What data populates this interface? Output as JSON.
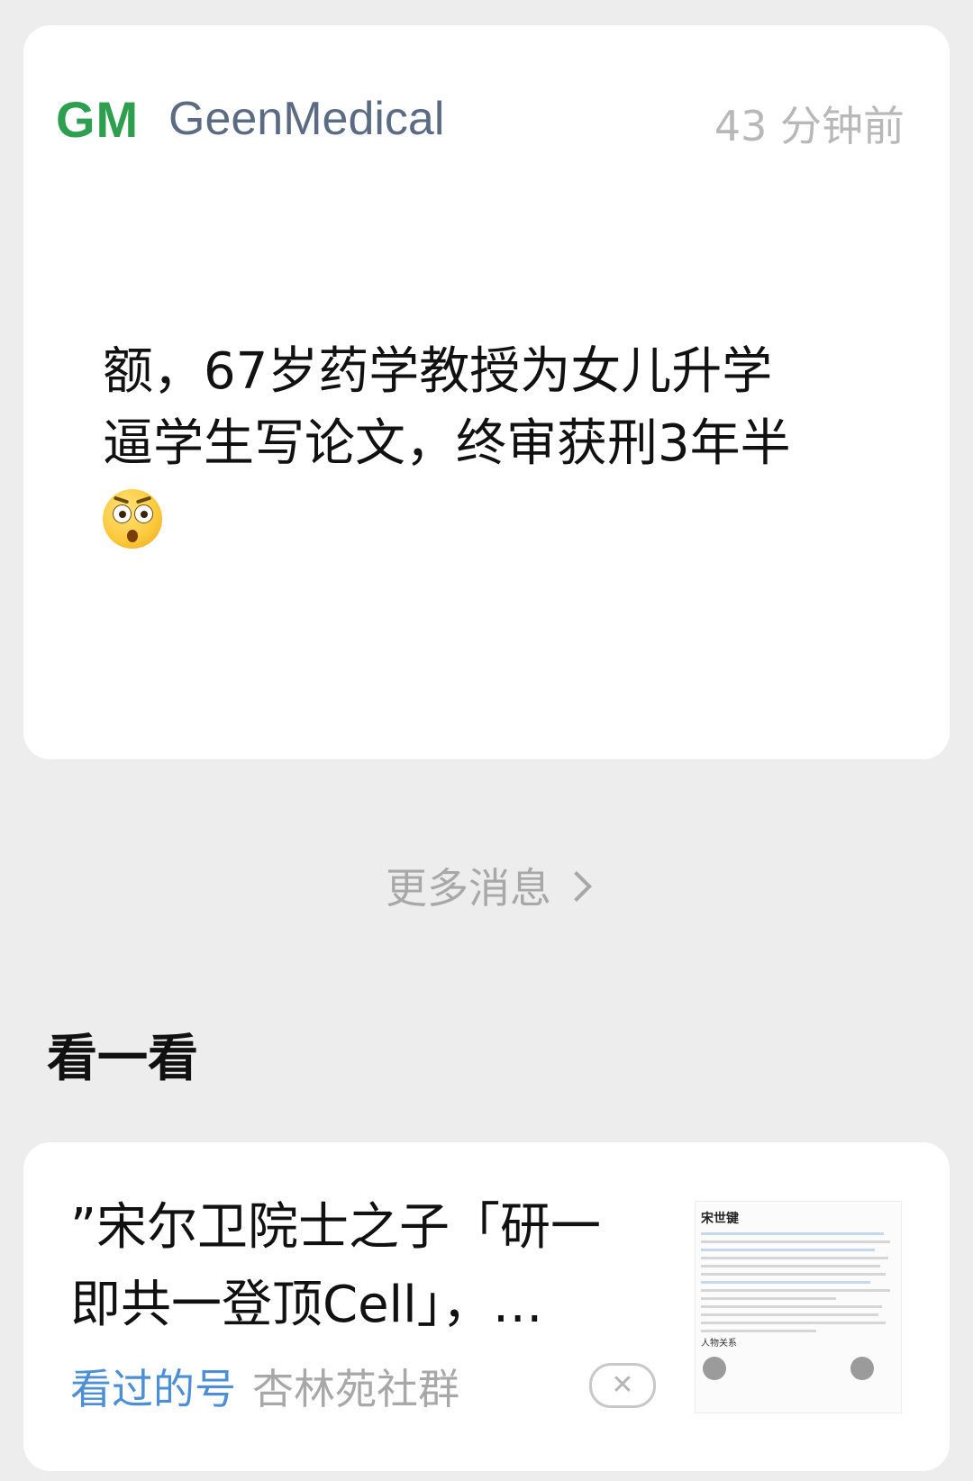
{
  "message_card": {
    "logo": "GM",
    "account_name": "GeenMedical",
    "time": "43 分钟前",
    "text_line1": "额，67岁药学教授为女儿升学",
    "text_line2": "逼学生写论文，终审获刑3年半",
    "emoji": "flushed-face-emoji"
  },
  "more_messages": {
    "label": "更多消息",
    "icon": "chevron-right-icon"
  },
  "section": {
    "title": "看一看"
  },
  "article": {
    "title_line1": "”宋尔卫院士之子「研一",
    "title_line2": "即共一登顶Cell」，…",
    "tag": "看过的号",
    "source": "杏林苑社群",
    "close_label": "✕",
    "thumbnail": {
      "name": "宋世键",
      "section": "人物关系"
    }
  },
  "colors": {
    "background": "#ededed",
    "card": "#ffffff",
    "logo_green": "#2e9e4f",
    "account_gray_blue": "#5b6b84",
    "tag_blue": "#4d8fd6",
    "muted": "#a8a8a8"
  }
}
